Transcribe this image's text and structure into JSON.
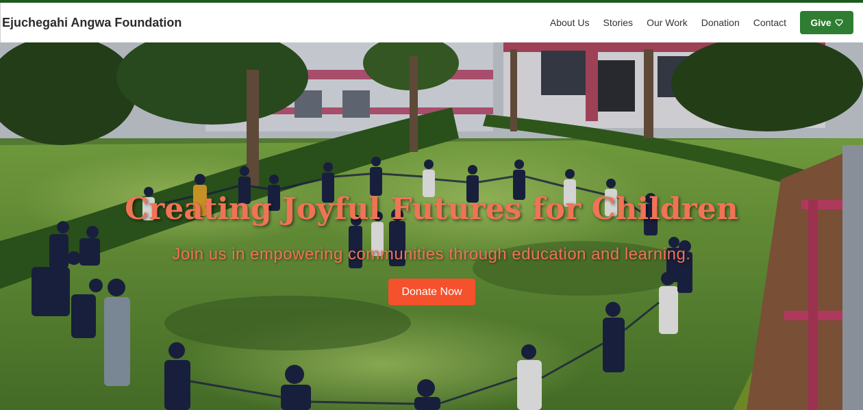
{
  "site": {
    "brand": "Ejuchegahi Angwa Foundation"
  },
  "nav": {
    "links": [
      "About Us",
      "Stories",
      "Our Work",
      "Donation",
      "Contact"
    ],
    "give_label": "Give",
    "give_icon": "heart-icon"
  },
  "hero": {
    "title": "Creating Joyful Futures for Children",
    "subtitle": "Join us in empowering communities through education and learning.",
    "cta_label": "Donate Now"
  },
  "colors": {
    "top_strip": "#1e5a1e",
    "give_button": "#2e7d32",
    "hero_text": "#f07355",
    "cta_button": "#f4512c"
  }
}
